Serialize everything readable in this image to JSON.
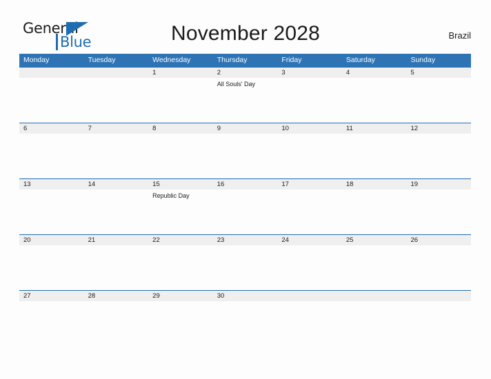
{
  "brand": {
    "word_one": "General",
    "word_two": "Blue",
    "triangle_color": "#1f6cb0",
    "text_color": "#1a1a1a"
  },
  "header": {
    "title": "November 2028",
    "region": "Brazil"
  },
  "colors": {
    "header_blue": "#2e74b5",
    "rule_blue": "#1f6cb0",
    "number_band": "#efefef",
    "page_background": "#fdfdfd"
  },
  "calendar": {
    "month": "November",
    "year": "2028",
    "weekday_headers": [
      "Monday",
      "Tuesday",
      "Wednesday",
      "Thursday",
      "Friday",
      "Saturday",
      "Sunday"
    ],
    "weeks": [
      {
        "days": [
          {
            "number": "",
            "event": ""
          },
          {
            "number": "",
            "event": ""
          },
          {
            "number": "1",
            "event": ""
          },
          {
            "number": "2",
            "event": "All Souls' Day"
          },
          {
            "number": "3",
            "event": ""
          },
          {
            "number": "4",
            "event": ""
          },
          {
            "number": "5",
            "event": ""
          }
        ]
      },
      {
        "days": [
          {
            "number": "6",
            "event": ""
          },
          {
            "number": "7",
            "event": ""
          },
          {
            "number": "8",
            "event": ""
          },
          {
            "number": "9",
            "event": ""
          },
          {
            "number": "10",
            "event": ""
          },
          {
            "number": "11",
            "event": ""
          },
          {
            "number": "12",
            "event": ""
          }
        ]
      },
      {
        "days": [
          {
            "number": "13",
            "event": ""
          },
          {
            "number": "14",
            "event": ""
          },
          {
            "number": "15",
            "event": "Republic Day"
          },
          {
            "number": "16",
            "event": ""
          },
          {
            "number": "17",
            "event": ""
          },
          {
            "number": "18",
            "event": ""
          },
          {
            "number": "19",
            "event": ""
          }
        ]
      },
      {
        "days": [
          {
            "number": "20",
            "event": ""
          },
          {
            "number": "21",
            "event": ""
          },
          {
            "number": "22",
            "event": ""
          },
          {
            "number": "23",
            "event": ""
          },
          {
            "number": "24",
            "event": ""
          },
          {
            "number": "25",
            "event": ""
          },
          {
            "number": "26",
            "event": ""
          }
        ]
      },
      {
        "days": [
          {
            "number": "27",
            "event": ""
          },
          {
            "number": "28",
            "event": ""
          },
          {
            "number": "29",
            "event": ""
          },
          {
            "number": "30",
            "event": ""
          },
          {
            "number": "",
            "event": ""
          },
          {
            "number": "",
            "event": ""
          },
          {
            "number": "",
            "event": ""
          }
        ]
      }
    ]
  }
}
